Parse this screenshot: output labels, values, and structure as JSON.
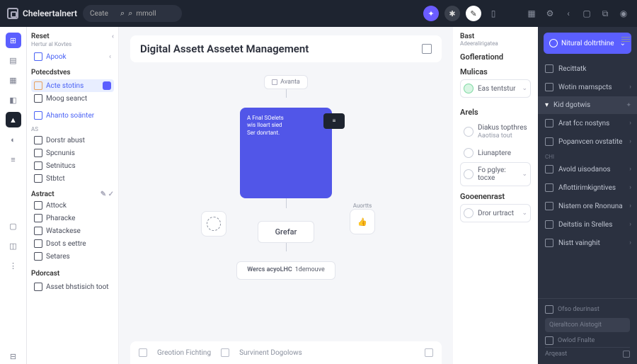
{
  "topbar": {
    "brand": "Cheleertalnert",
    "search1": "Ceate",
    "search2": "mmoll"
  },
  "left": {
    "head": "Reset",
    "sub": "Hertur al Kovtes",
    "apook": "Apook",
    "sec1": "Potecdstves",
    "items1": [
      "Acte stotins",
      "Moog seanct"
    ],
    "blue": "Ahanto soänter",
    "tiny": "AS",
    "items2": [
      "Dorstr abust",
      "Spcnunis",
      "Setnitucs",
      "Stbtct"
    ],
    "sec2": "Astract",
    "items3": [
      "Attock",
      "Pharacke",
      "Watackese",
      "Dsot s eettre",
      "Setares"
    ],
    "sec3": "Pdorcast",
    "foot": "Asset bhstisich toot"
  },
  "canvas": {
    "title": "Digital Assett Assetet Management",
    "node_top": "Avanta",
    "card": {
      "l1": "A Fnal SOelets",
      "l2": "wis Iloart sied",
      "l3": "Ser donrtant."
    },
    "side_label": "Auortts",
    "node_mid": "Grefar",
    "node_bot_l1": "Wercs acyoLHC",
    "node_bot_l2": "1demouve",
    "bb1": "Greotion Fichting",
    "bb2": "Survinent Dogolows"
  },
  "right": {
    "head": "Bast",
    "sub": "Adeeralirigatea",
    "s1": "Goflerationd",
    "s2": "Mulicas",
    "i1": "Eas tentstur",
    "s3": "Arels",
    "i2a": "Diakus topthres",
    "i2b": "Aaotisa tout",
    "i3": "Liunaptere",
    "i4": "Fo pglye: tocxe",
    "s4": "Gooenenrast",
    "i5": "Dror urtract"
  },
  "far": {
    "search": "Nitural doltrthine",
    "items": [
      "Recittatk",
      "Wotin mamspcts",
      "Kid dgotwis",
      "Arat fcc nostyns",
      "Popanvcen ovstatite"
    ],
    "tiny": "CHI",
    "items2": [
      "Avold uisodanos",
      "Aflottirimkigntives",
      "Nistem ore Rnonuna",
      "Deitstis in Srelles",
      "Nistt vainghit"
    ],
    "f1": "Ofso deurinast",
    "f2": "Qieraltcon Aistogit",
    "f3": "Owlod Fnalte",
    "f4": "Arqeast"
  }
}
